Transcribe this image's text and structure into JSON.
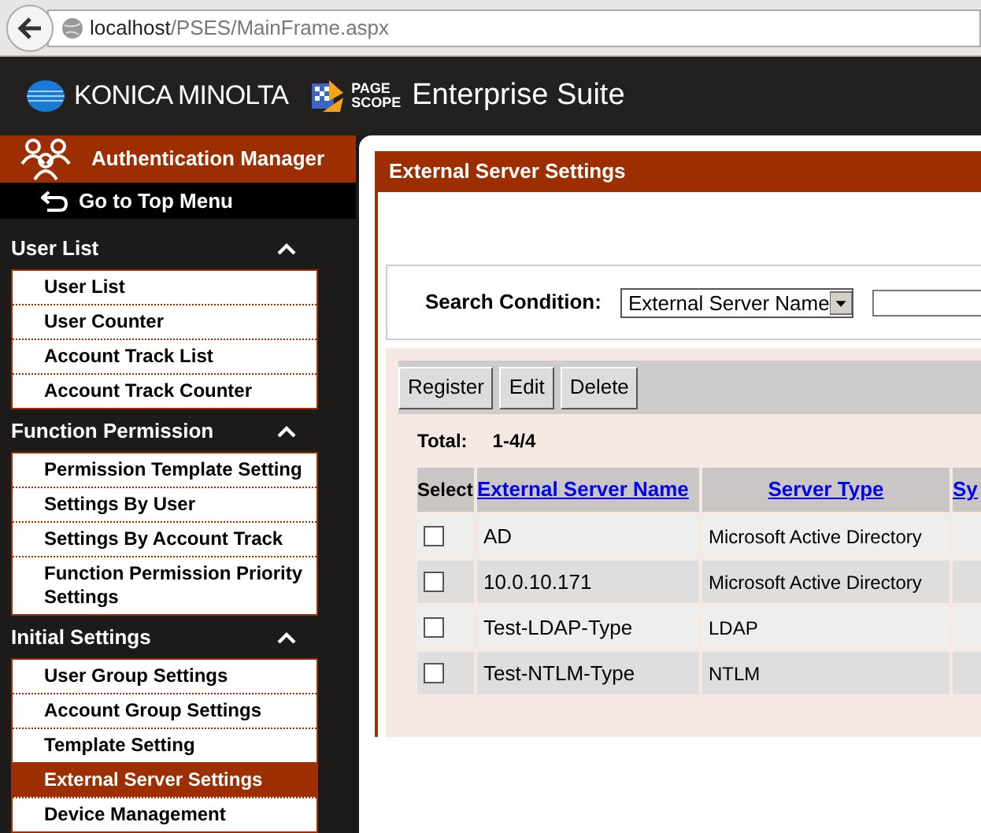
{
  "browser": {
    "url_host": "localhost",
    "url_path": "/PSES/MainFrame.aspx"
  },
  "header": {
    "brand": "KONICA MINOLTA",
    "product_mark_top": "PAGE",
    "product_mark_bottom": "SCOPE",
    "product": "Enterprise Suite"
  },
  "sidebar": {
    "app_title": "Authentication Manager",
    "top_menu": "Go to Top Menu",
    "sections": [
      {
        "title": "User List",
        "expanded": true,
        "items": [
          {
            "label": "User List",
            "selected": false
          },
          {
            "label": "User Counter",
            "selected": false
          },
          {
            "label": "Account Track List",
            "selected": false
          },
          {
            "label": "Account Track Counter",
            "selected": false
          }
        ]
      },
      {
        "title": "Function Permission",
        "expanded": true,
        "items": [
          {
            "label": "Permission Template Setting",
            "selected": false
          },
          {
            "label": "Settings By User",
            "selected": false
          },
          {
            "label": "Settings By Account Track",
            "selected": false
          },
          {
            "label": "Function Permission Priority Settings",
            "selected": false
          }
        ]
      },
      {
        "title": "Initial Settings",
        "expanded": true,
        "items": [
          {
            "label": "User Group Settings",
            "selected": false
          },
          {
            "label": "Account Group Settings",
            "selected": false
          },
          {
            "label": "Template Setting",
            "selected": false
          },
          {
            "label": "External Server Settings",
            "selected": true
          },
          {
            "label": "Device Management",
            "selected": false
          }
        ]
      }
    ]
  },
  "panel": {
    "title": "External Server Settings",
    "search": {
      "label": "Search Condition:",
      "condition": "External Server Name"
    },
    "buttons": [
      "Register",
      "Edit",
      "Delete"
    ],
    "total_label": "Total:",
    "total_value": "1-4/4",
    "table": {
      "columns": [
        "Select",
        "External Server Name",
        "Server Type",
        "Sy"
      ],
      "rows": [
        {
          "checked": false,
          "name": "AD",
          "type": "Microsoft Active Directory"
        },
        {
          "checked": false,
          "name": "10.0.10.171",
          "type": "Microsoft Active Directory"
        },
        {
          "checked": false,
          "name": "Test-LDAP-Type",
          "type": "LDAP"
        },
        {
          "checked": false,
          "name": "Test-NTLM-Type",
          "type": "NTLM"
        }
      ]
    }
  }
}
